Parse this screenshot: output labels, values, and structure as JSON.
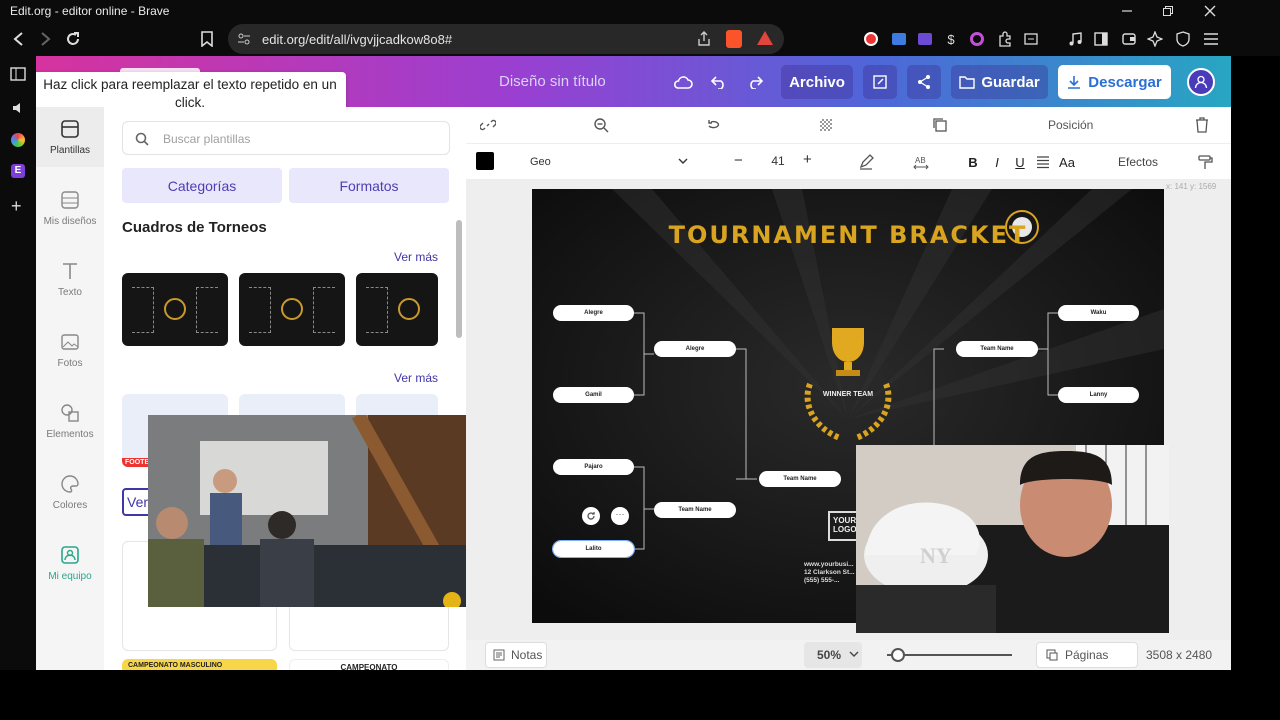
{
  "window": {
    "title": "Edit.org - editor online - Brave"
  },
  "browser": {
    "url": "edit.org/edit/all/ivgvjjcadkow8o8#"
  },
  "header": {
    "tooltip": "Haz click para reemplazar el texto repetido en un click.",
    "doc_title": "Diseño sin título",
    "archivo": "Archivo",
    "guardar": "Guardar",
    "descargar": "Descargar"
  },
  "rail": {
    "items": [
      {
        "label": "Plantillas"
      },
      {
        "label": "Mis diseños"
      },
      {
        "label": "Texto"
      },
      {
        "label": "Fotos"
      },
      {
        "label": "Elementos"
      },
      {
        "label": "Colores"
      },
      {
        "label": "Mi equipo"
      }
    ]
  },
  "panel": {
    "search_placeholder": "Buscar plantillas",
    "categorias": "Categorías",
    "formatos": "Formatos",
    "section_title": "Cuadros de Torneos",
    "ver_mas": "Ver más",
    "ver_partial": "Ver",
    "footer_label_1": "CAMPEONATO MASCULINO",
    "footer_label_2": "CAMPEONATO",
    "thumb_tag": "FOOTB"
  },
  "toolbar": {
    "posicion": "Posición",
    "font": "Geo",
    "font_size": "41",
    "efectos": "Efectos",
    "italic": "I",
    "bold": "B",
    "underline": "U",
    "case": "Aa",
    "coords": "x: 141 y: 1569"
  },
  "design": {
    "title": "TOURNAMENT BRACKET",
    "winner": "WINNER TEAM",
    "left_r1": [
      "Alegre",
      "Gamil",
      "Pajaro",
      "Lalito"
    ],
    "left_r2": [
      "Alegre",
      "Team Name"
    ],
    "final": "Team Name",
    "right_r2": "Team Name",
    "right_r1": [
      "Waku",
      "Lanny"
    ],
    "logo": "YOUR LOGO",
    "contact": [
      "www.yourbusi...",
      "12 Clarkson St...",
      "(555) 555-..."
    ]
  },
  "bottom": {
    "notas": "Notas",
    "zoom": "50%",
    "paginas": "Páginas",
    "dims": "3508 x 2480",
    "help": "?",
    "zoom_fraction": 0.05
  },
  "colors": {
    "accent": "#4b3fb2",
    "descargar_bg": "#ffffff",
    "descargar_fg": "#2a6fd6",
    "gold": "#d9a520"
  }
}
